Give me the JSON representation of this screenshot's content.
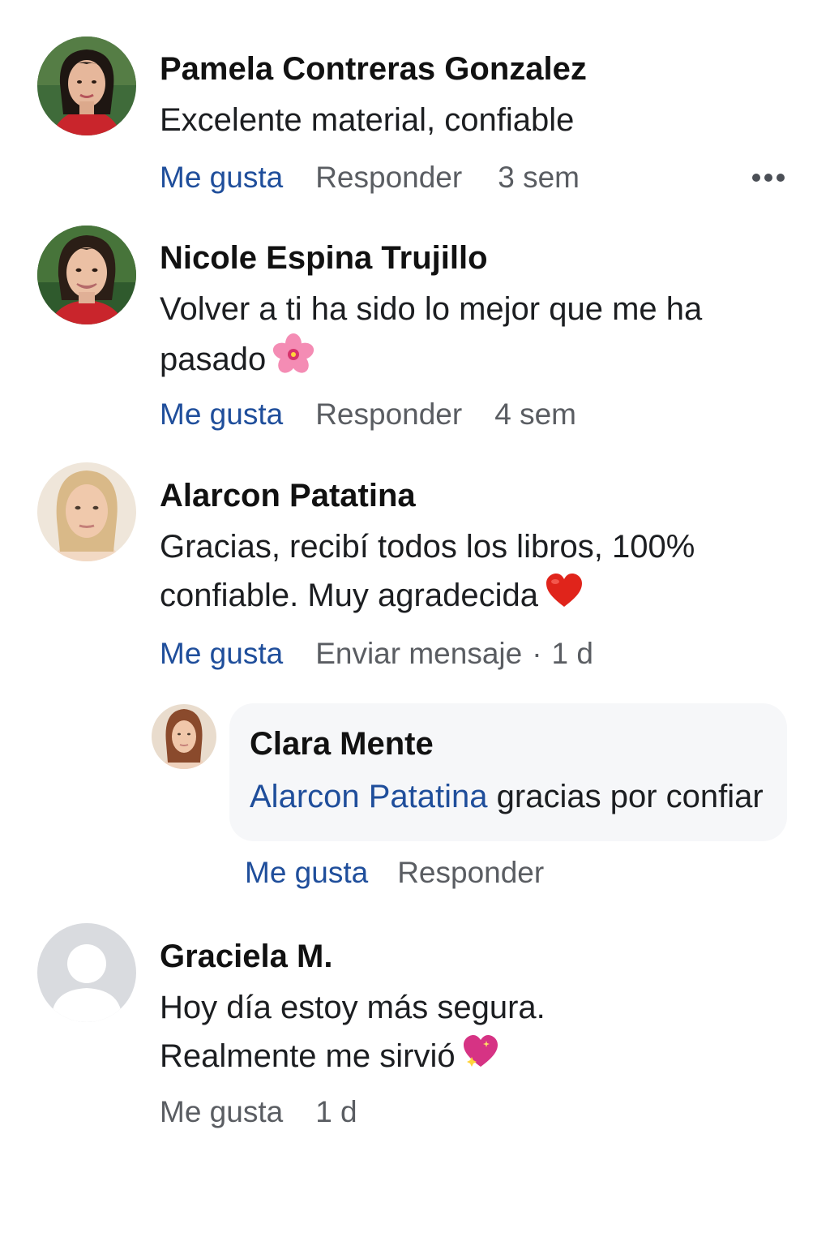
{
  "comments": [
    {
      "author": "Pamela Contreras Gonzalez",
      "lines": [
        "Excelente material, confiable"
      ],
      "like_label": "Me gusta",
      "reply_label": "Responder",
      "time": "3 sem",
      "more_icon": "more-options-icon"
    },
    {
      "author": "Nicole Espina Trujillo",
      "lines": [
        "Volver a ti ha sido lo mejor que me ha",
        "pasado"
      ],
      "emoji": "hibiscus-icon",
      "like_label": "Me gusta",
      "reply_label": "Responder",
      "time": "4 sem"
    },
    {
      "author": "Alarcon Patatina",
      "lines": [
        "Gracias, recibí todos los libros, 100%",
        "confiable. Muy agradecida"
      ],
      "emoji": "red-heart-icon",
      "like_label": "Me gusta",
      "message_label": "Enviar mensaje",
      "separator": "·",
      "time": "1 d"
    },
    {
      "author": "Graciela M.",
      "lines": [
        "Hoy día estoy más segura.",
        "Realmente me sirvió"
      ],
      "emoji": "sparkling-heart-icon",
      "like_label": "Me gusta",
      "time": "1 d"
    }
  ],
  "reply": {
    "author": "Clara Mente",
    "mention": "Alarcon Patatina",
    "text": "gracias por confiar",
    "like_label": "Me gusta",
    "reply_label": "Responder"
  },
  "colors": {
    "link_blue": "#1f4e9b",
    "meta_gray": "#5a5d62",
    "bubble_bg": "#f6f7f9"
  }
}
